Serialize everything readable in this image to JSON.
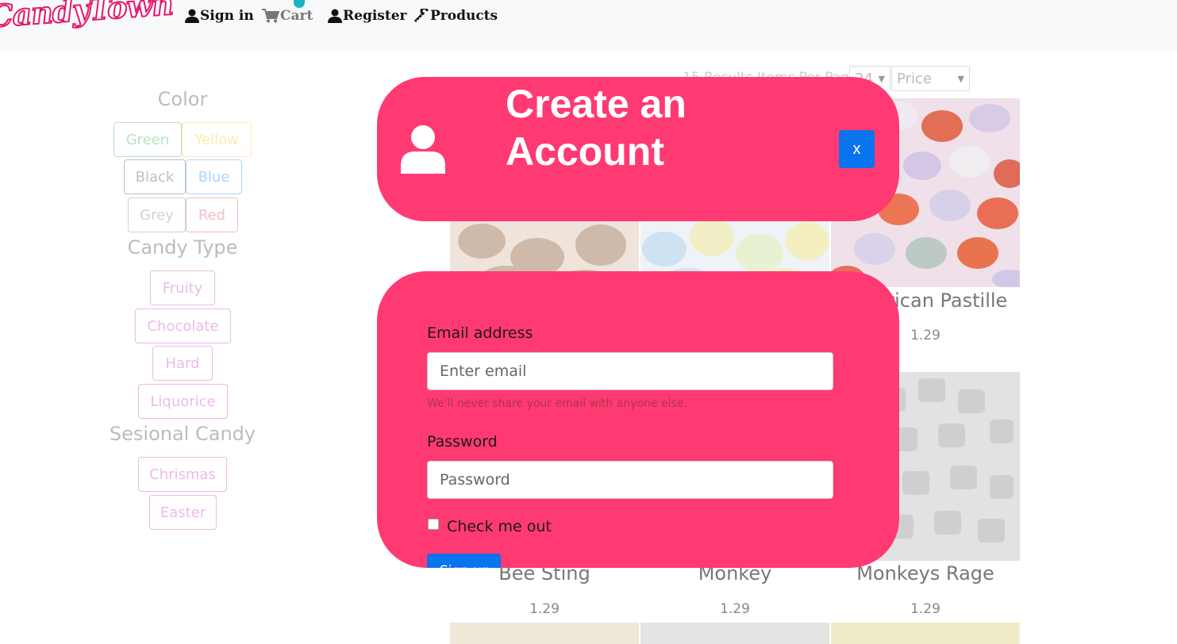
{
  "nav": {
    "logo": "CandyTown",
    "sign_in": "Sign in",
    "cart": "Cart",
    "register": "Register",
    "products": "Products"
  },
  "sidebar": {
    "color_title": "Color",
    "colors": [
      {
        "label": "Green",
        "color": "#28a745"
      },
      {
        "label": "Yellow",
        "color": "#ffc107"
      },
      {
        "label": "Black",
        "color": "#343a40"
      },
      {
        "label": "Blue",
        "color": "#007bff"
      },
      {
        "label": "Grey",
        "color": "#6c757d"
      },
      {
        "label": "Red",
        "color": "#dc3545"
      }
    ],
    "type_title": "Candy Type",
    "types": [
      "Fruity",
      "Chocolate",
      "Hard",
      "Liquorice"
    ],
    "season_title": "Sesional Candy",
    "seasons": [
      "Chrismas",
      "Easter"
    ],
    "chip_accent": "#c42bb9"
  },
  "toolbar": {
    "results_text": "15 Results   Items Per Page",
    "per_page": "24",
    "sort": "Price"
  },
  "products": [
    {
      "title": "",
      "price": ""
    },
    {
      "title": "",
      "price": ""
    },
    {
      "title": "American Pastille",
      "price": "1.29"
    },
    {
      "title": "Bee Sting",
      "price": "1.29"
    },
    {
      "title": "Monkey",
      "price": "1.29"
    },
    {
      "title": "Monkeys Rage",
      "price": "1.29"
    }
  ],
  "modal": {
    "title": "Create an Account",
    "close_label": "x",
    "email_label": "Email address",
    "email_placeholder": "Enter email",
    "email_help": "We'll never share your email with anyone else.",
    "password_label": "Password",
    "password_placeholder": "Password",
    "check_label": "Check me out",
    "submit_label": "Sign up",
    "accent": "#ff3a72",
    "button_color": "#0a73ee"
  }
}
